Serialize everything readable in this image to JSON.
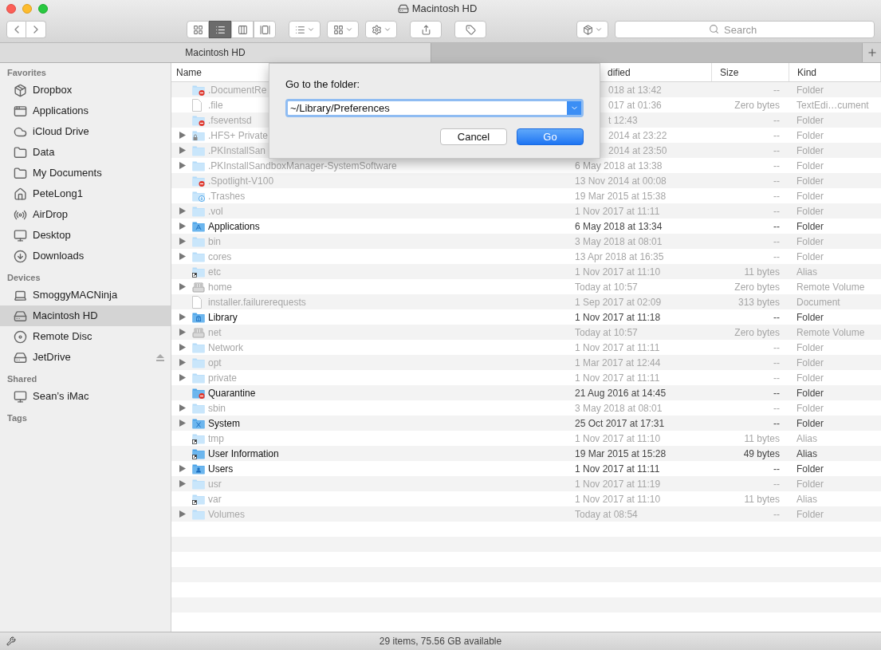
{
  "window": {
    "title": "Macintosh HD"
  },
  "toolbar": {
    "views": [
      {
        "kind": "icons",
        "selected": false
      },
      {
        "kind": "list",
        "selected": true
      },
      {
        "kind": "columns",
        "selected": false
      },
      {
        "kind": "gallery",
        "selected": false
      }
    ],
    "search": {
      "placeholder": "Search"
    }
  },
  "tabs": [
    {
      "label": "Macintosh HD",
      "selected": true
    },
    {
      "selected": false
    }
  ],
  "sidebar": [
    {
      "heading": "Favorites",
      "items": [
        {
          "label": "Dropbox",
          "kind": "dropbox",
          "selected": false
        },
        {
          "label": "Applications",
          "kind": "apps",
          "selected": false
        },
        {
          "label": "iCloud Drive",
          "kind": "cloud",
          "selected": false
        },
        {
          "label": "Data",
          "kind": "folder",
          "selected": false
        },
        {
          "label": "My Documents",
          "kind": "folder",
          "selected": false
        },
        {
          "label": "PeteLong1",
          "kind": "home",
          "selected": false
        },
        {
          "label": "AirDrop",
          "kind": "airdrop",
          "selected": false
        },
        {
          "label": "Desktop",
          "kind": "desktop",
          "selected": false
        },
        {
          "label": "Downloads",
          "kind": "downloads",
          "selected": false
        }
      ]
    },
    {
      "heading": "Devices",
      "items": [
        {
          "label": "SmoggyMACNinja",
          "kind": "laptop",
          "selected": false
        },
        {
          "label": "Macintosh HD",
          "kind": "disk",
          "selected": true
        },
        {
          "label": "Remote Disc",
          "kind": "disc",
          "selected": false
        },
        {
          "label": "JetDrive",
          "kind": "disk",
          "selected": false,
          "ejectable": true
        }
      ]
    },
    {
      "heading": "Shared",
      "items": [
        {
          "label": "Sean’s iMac",
          "kind": "desktop",
          "selected": false
        }
      ]
    },
    {
      "heading": "Tags"
    }
  ],
  "table": {
    "columns": [
      "Name",
      "dified",
      "Size",
      "Kind"
    ],
    "rows": [
      {
        "name": ".DocumentRe",
        "date": "018 at 13:42",
        "size": "--",
        "kind_label": "Folder",
        "kind": "restricted",
        "dimmed": true,
        "expandable": false,
        "covered": true
      },
      {
        "name": ".file",
        "date": "017 at 01:36",
        "size": "Zero bytes",
        "kind_label": "TextEdi…cument",
        "kind": "document",
        "dimmed": true,
        "expandable": false,
        "covered": true
      },
      {
        "name": ".fseventsd",
        "date": "t 12:43",
        "size": "--",
        "kind_label": "Folder",
        "kind": "restricted",
        "dimmed": true,
        "expandable": false,
        "covered": true
      },
      {
        "name": ".HFS+ Private",
        "date": "2014 at 23:22",
        "size": "--",
        "kind_label": "Folder",
        "kind": "lock",
        "dimmed": true,
        "expandable": true,
        "covered": true
      },
      {
        "name": ".PKInstallSan",
        "date": "2014 at 23:50",
        "size": "--",
        "kind_label": "Folder",
        "kind": "folder",
        "dimmed": true,
        "expandable": true,
        "covered": true
      },
      {
        "name": ".PKInstallSandboxManager-SystemSoftware",
        "date": "6 May 2018 at 13:38",
        "size": "--",
        "kind_label": "Folder",
        "kind": "folder",
        "dimmed": true,
        "expandable": true,
        "covered": false
      },
      {
        "name": ".Spotlight-V100",
        "date": "13 Nov 2014 at 00:08",
        "size": "--",
        "kind_label": "Folder",
        "kind": "restricted",
        "dimmed": true,
        "expandable": false,
        "covered": false
      },
      {
        "name": ".Trashes",
        "date": "19 Mar 2015 at 15:38",
        "size": "--",
        "kind_label": "Folder",
        "kind": "download",
        "dimmed": true,
        "expandable": false,
        "covered": false
      },
      {
        "name": ".vol",
        "date": "1 Nov 2017 at 11:11",
        "size": "--",
        "kind_label": "Folder",
        "kind": "folder",
        "dimmed": true,
        "expandable": true,
        "covered": false
      },
      {
        "name": "Applications",
        "date": "6 May 2018 at 13:34",
        "size": "--",
        "kind_label": "Folder",
        "kind": "apps",
        "dimmed": false,
        "expandable": true,
        "covered": false
      },
      {
        "name": "bin",
        "date": "3 May 2018 at 08:01",
        "size": "--",
        "kind_label": "Folder",
        "kind": "folder",
        "dimmed": true,
        "expandable": true,
        "covered": false
      },
      {
        "name": "cores",
        "date": "13 Apr 2018 at 16:35",
        "size": "--",
        "kind_label": "Folder",
        "kind": "folder",
        "dimmed": true,
        "expandable": true,
        "covered": false
      },
      {
        "name": "etc",
        "date": "1 Nov 2017 at 11:10",
        "size": "11 bytes",
        "kind_label": "Alias",
        "kind": "alias",
        "dimmed": true,
        "expandable": false,
        "covered": false
      },
      {
        "name": "home",
        "date": "Today at 10:57",
        "size": "Zero bytes",
        "kind_label": "Remote Volume",
        "kind": "drive",
        "dimmed": true,
        "expandable": true,
        "covered": false
      },
      {
        "name": "installer.failurerequests",
        "date": "1 Sep 2017 at 02:09",
        "size": "313 bytes",
        "kind_label": "Document",
        "kind": "document",
        "dimmed": true,
        "expandable": false,
        "covered": false
      },
      {
        "name": "Library",
        "date": "1 Nov 2017 at 11:18",
        "size": "--",
        "kind_label": "Folder",
        "kind": "library",
        "dimmed": false,
        "expandable": true,
        "covered": false
      },
      {
        "name": "net",
        "date": "Today at 10:57",
        "size": "Zero bytes",
        "kind_label": "Remote Volume",
        "kind": "drive",
        "dimmed": true,
        "expandable": true,
        "covered": false
      },
      {
        "name": "Network",
        "date": "1 Nov 2017 at 11:11",
        "size": "--",
        "kind_label": "Folder",
        "kind": "folder",
        "dimmed": true,
        "expandable": true,
        "covered": false
      },
      {
        "name": "opt",
        "date": "1 Mar 2017 at 12:44",
        "size": "--",
        "kind_label": "Folder",
        "kind": "folder",
        "dimmed": true,
        "expandable": true,
        "covered": false
      },
      {
        "name": "private",
        "date": "1 Nov 2017 at 11:11",
        "size": "--",
        "kind_label": "Folder",
        "kind": "folder",
        "dimmed": true,
        "expandable": true,
        "covered": false
      },
      {
        "name": "Quarantine",
        "date": "21 Aug 2016 at 14:45",
        "size": "--",
        "kind_label": "Folder",
        "kind": "restricted",
        "dimmed": false,
        "expandable": false,
        "covered": false
      },
      {
        "name": "sbin",
        "date": "3 May 2018 at 08:01",
        "size": "--",
        "kind_label": "Folder",
        "kind": "folder",
        "dimmed": true,
        "expandable": true,
        "covered": false
      },
      {
        "name": "System",
        "date": "25 Oct 2017 at 17:31",
        "size": "--",
        "kind_label": "Folder",
        "kind": "system",
        "dimmed": false,
        "expandable": true,
        "covered": false
      },
      {
        "name": "tmp",
        "date": "1 Nov 2017 at 11:10",
        "size": "11 bytes",
        "kind_label": "Alias",
        "kind": "alias",
        "dimmed": true,
        "expandable": false,
        "covered": false
      },
      {
        "name": "User Information",
        "date": "19 Mar 2015 at 15:28",
        "size": "49 bytes",
        "kind_label": "Alias",
        "kind": "alias",
        "dimmed": false,
        "expandable": false,
        "covered": false
      },
      {
        "name": "Users",
        "date": "1 Nov 2017 at 11:11",
        "size": "--",
        "kind_label": "Folder",
        "kind": "user",
        "dimmed": false,
        "expandable": true,
        "covered": false
      },
      {
        "name": "usr",
        "date": "1 Nov 2017 at 11:19",
        "size": "--",
        "kind_label": "Folder",
        "kind": "folder",
        "dimmed": true,
        "expandable": true,
        "covered": false
      },
      {
        "name": "var",
        "date": "1 Nov 2017 at 11:10",
        "size": "11 bytes",
        "kind_label": "Alias",
        "kind": "alias",
        "dimmed": true,
        "expandable": false,
        "covered": false
      },
      {
        "name": "Volumes",
        "date": "Today at 08:54",
        "size": "--",
        "kind_label": "Folder",
        "kind": "folder",
        "dimmed": true,
        "expandable": true,
        "covered": false
      }
    ]
  },
  "dialog": {
    "title": "Go to the folder:",
    "value": "~/Library/Preferences",
    "buttons": [
      {
        "label": "Cancel",
        "kind": "secondary"
      },
      {
        "label": "Go",
        "kind": "primary"
      }
    ]
  },
  "status_bar": {
    "text": "29 items, 75.56 GB available"
  }
}
